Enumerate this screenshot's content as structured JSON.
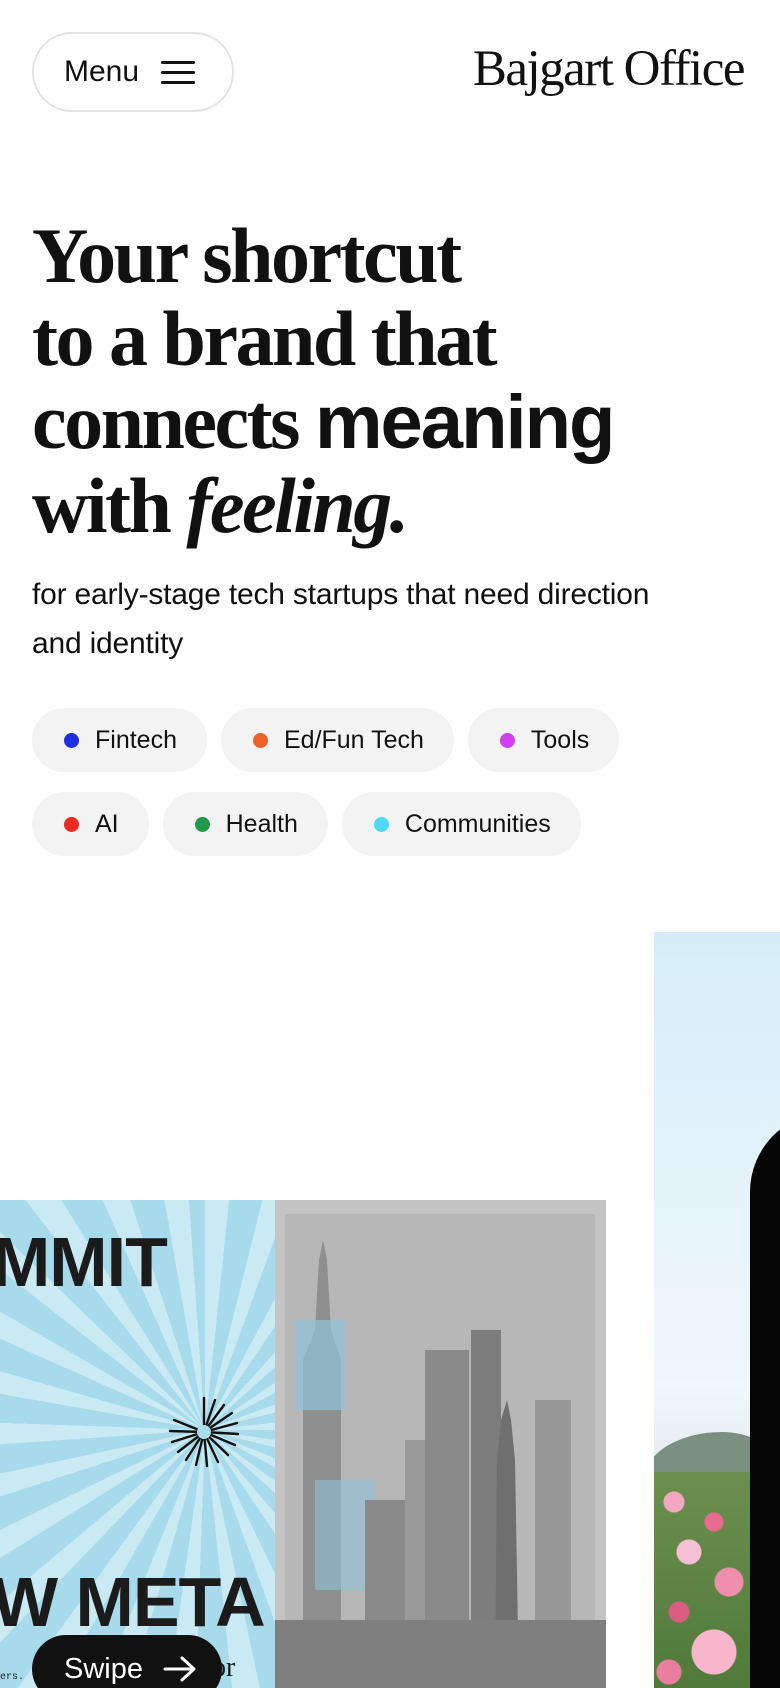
{
  "header": {
    "menu_label": "Menu",
    "logo": "Bajgart Office"
  },
  "hero": {
    "line1": "Your shortcut",
    "line2": "to a brand that",
    "line3_serif": "connects",
    "line3_sans": "meaning",
    "line4_serif": "with",
    "line4_italic": "feeling."
  },
  "subtitle": "for early-stage tech startups that need direction and identity",
  "tags": [
    {
      "label": "Fintech",
      "color": "#1f2ee0"
    },
    {
      "label": "Ed/Fun Tech",
      "color": "#f0602a"
    },
    {
      "label": "Tools",
      "color": "#d23ff0"
    },
    {
      "label": "AI",
      "color": "#ee2a22"
    },
    {
      "label": "Health",
      "color": "#1e9a4a"
    },
    {
      "label": "Communities",
      "color": "#4fd8f4"
    }
  ],
  "gallery": {
    "card_left": {
      "heading_top": "MMIT",
      "heading_bottom": "W META",
      "tiny_text": "ers.",
      "or_text": "or"
    },
    "swipe_label": "Swipe"
  }
}
